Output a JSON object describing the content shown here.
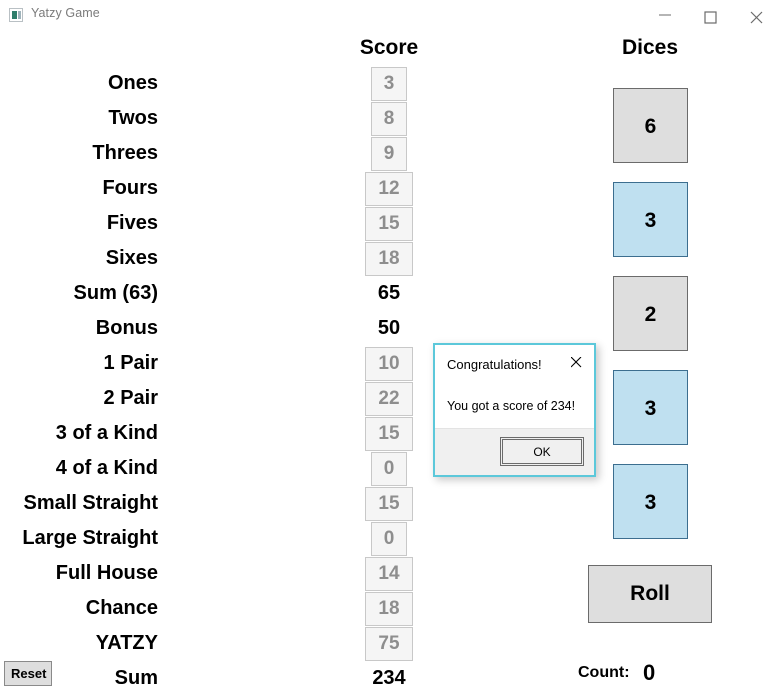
{
  "window": {
    "title": "Yatzy Game",
    "icon": "app-icon",
    "controls": {
      "minimize": "minimize-icon",
      "maximize": "maximize-icon",
      "close": "close-icon"
    }
  },
  "headers": {
    "score": "Score",
    "dices": "Dices"
  },
  "scoreboard": {
    "rows": [
      {
        "label": "Ones",
        "value": "3",
        "kind": "button"
      },
      {
        "label": "Twos",
        "value": "8",
        "kind": "button"
      },
      {
        "label": "Threes",
        "value": "9",
        "kind": "button"
      },
      {
        "label": "Fours",
        "value": "12",
        "kind": "button"
      },
      {
        "label": "Fives",
        "value": "15",
        "kind": "button"
      },
      {
        "label": "Sixes",
        "value": "18",
        "kind": "button"
      },
      {
        "label": "Sum (63)",
        "value": "65",
        "kind": "text"
      },
      {
        "label": "Bonus",
        "value": "50",
        "kind": "text"
      },
      {
        "label": "1 Pair",
        "value": "10",
        "kind": "button"
      },
      {
        "label": "2 Pair",
        "value": "22",
        "kind": "button"
      },
      {
        "label": "3 of a Kind",
        "value": "15",
        "kind": "button"
      },
      {
        "label": "4 of a Kind",
        "value": "0",
        "kind": "button"
      },
      {
        "label": "Small Straight",
        "value": "15",
        "kind": "button"
      },
      {
        "label": "Large Straight",
        "value": "0",
        "kind": "button"
      },
      {
        "label": "Full House",
        "value": "14",
        "kind": "button"
      },
      {
        "label": "Chance",
        "value": "18",
        "kind": "button"
      },
      {
        "label": "YATZY",
        "value": "75",
        "kind": "button"
      },
      {
        "label": "Sum",
        "value": "234",
        "kind": "text"
      }
    ]
  },
  "dice": [
    {
      "value": "6",
      "held": false
    },
    {
      "value": "3",
      "held": true
    },
    {
      "value": "2",
      "held": false
    },
    {
      "value": "3",
      "held": true
    },
    {
      "value": "3",
      "held": true
    }
  ],
  "roll_button": "Roll",
  "reset_button": "Reset",
  "count": {
    "label": "Count:",
    "value": "0"
  },
  "dialog": {
    "title": "Congratulations!",
    "message": "You got a score of 234!",
    "ok_label": "OK",
    "close_icon": "close-icon"
  },
  "colors": {
    "die_held": "#bfe0f0",
    "die_normal": "#dedede",
    "dialog_border": "#5cc8da",
    "score_button_text": "#8e8e8e"
  }
}
